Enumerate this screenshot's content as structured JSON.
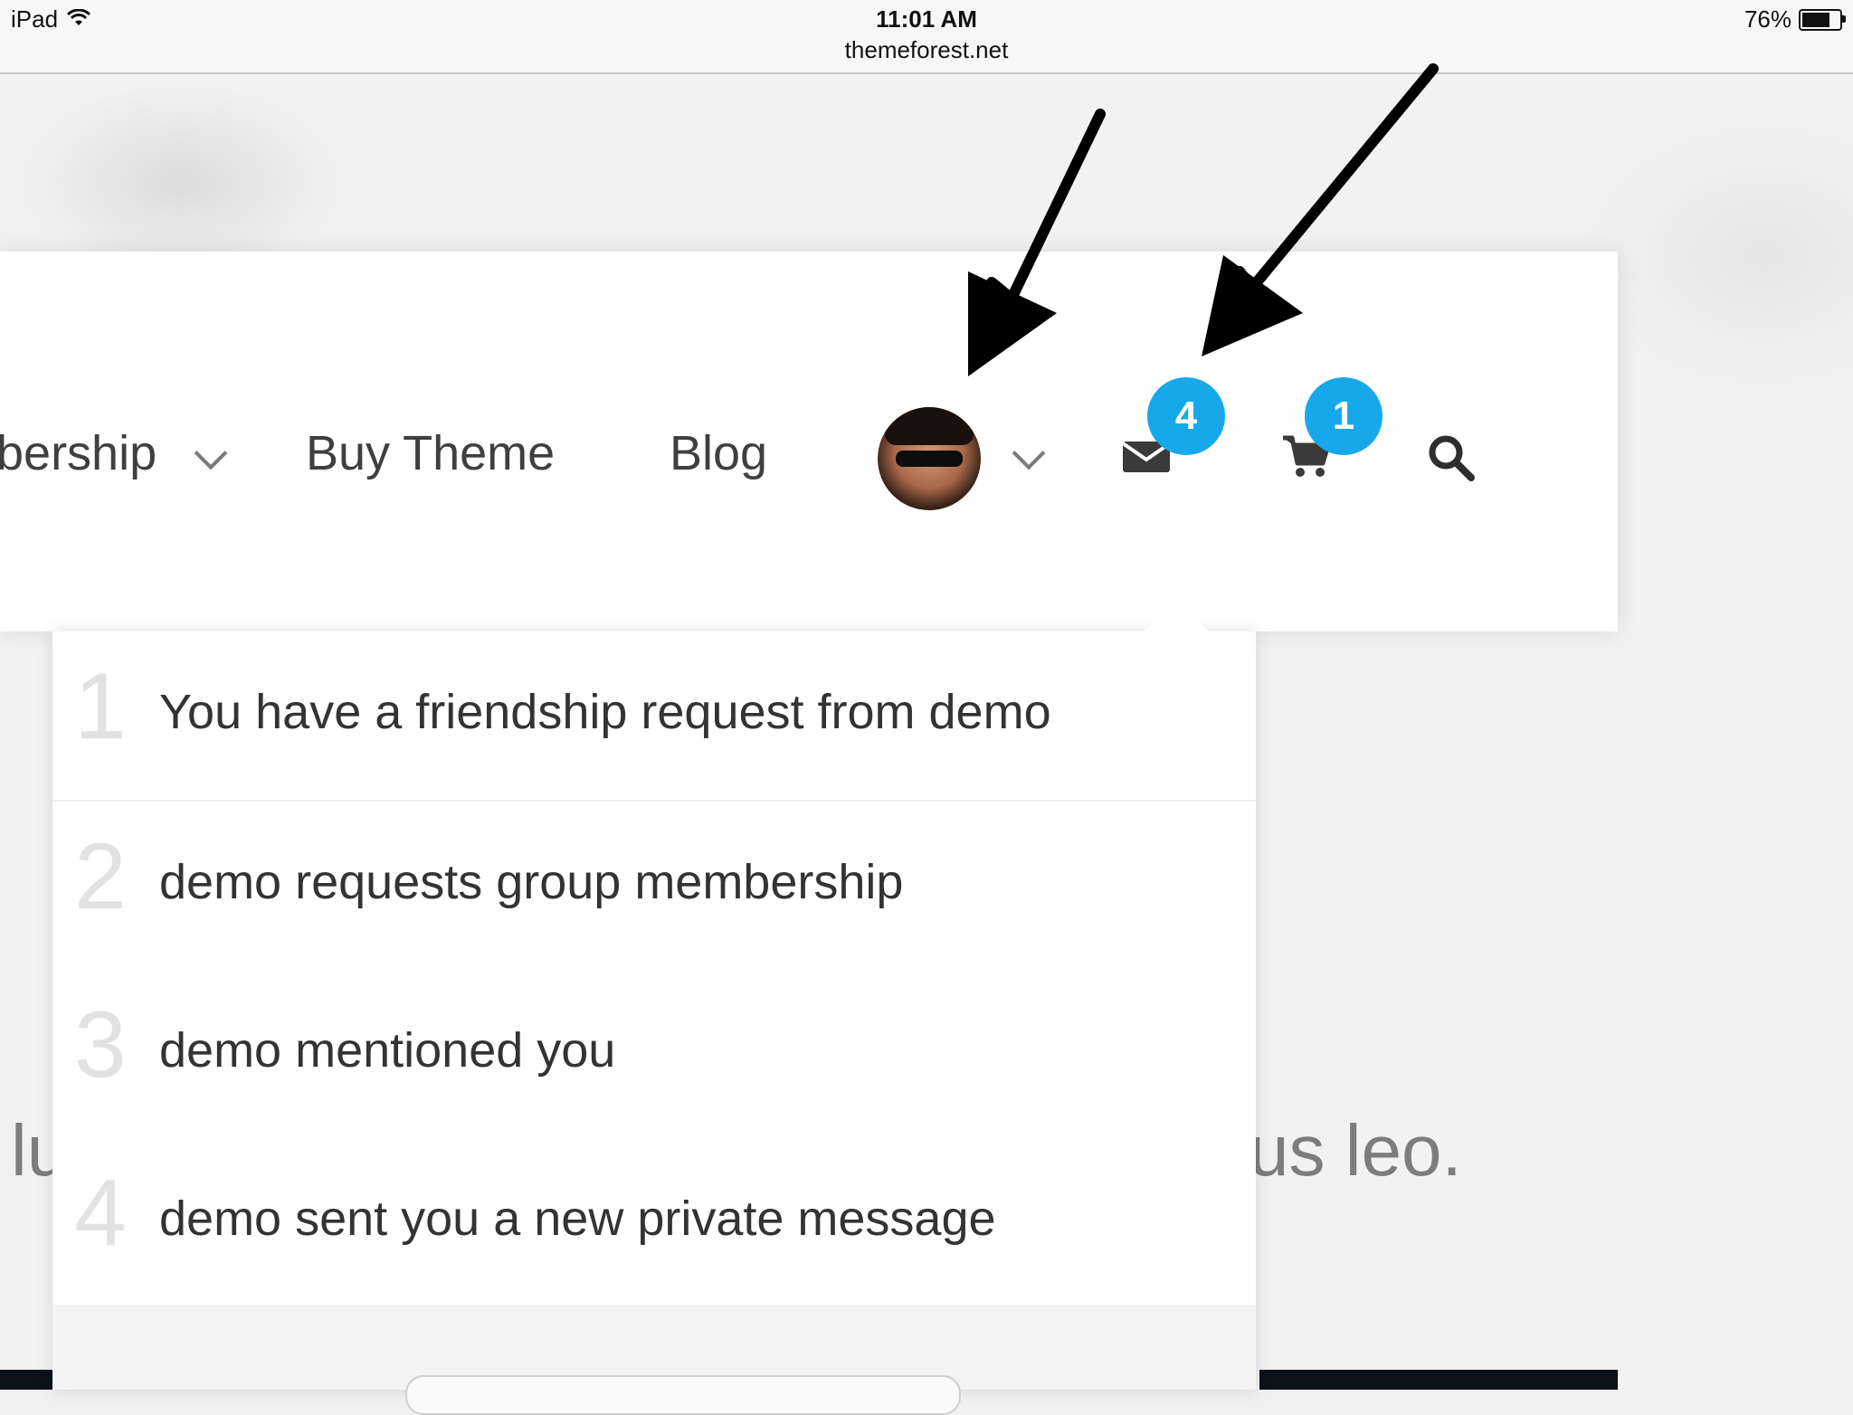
{
  "status_bar": {
    "device": "iPad",
    "time": "11:01 AM",
    "url": "themeforest.net",
    "battery": "76%",
    "battery_level": 0.76
  },
  "nav": {
    "membership_partial": "bership",
    "buy_theme": "Buy Theme",
    "blog": "Blog"
  },
  "icons": {
    "messages_badge": "4",
    "cart_badge": "1"
  },
  "notifications": [
    {
      "num": "1",
      "text": "You have a friendship request from demo"
    },
    {
      "num": "2",
      "text": "demo requests group membership"
    },
    {
      "num": "3",
      "text": "demo mentioned you"
    },
    {
      "num": "4",
      "text": "demo sent you a new private message"
    }
  ],
  "background_text": {
    "left": "lu",
    "right": "us leo."
  },
  "colors": {
    "badge": "#17a8ec",
    "text": "#333333"
  }
}
